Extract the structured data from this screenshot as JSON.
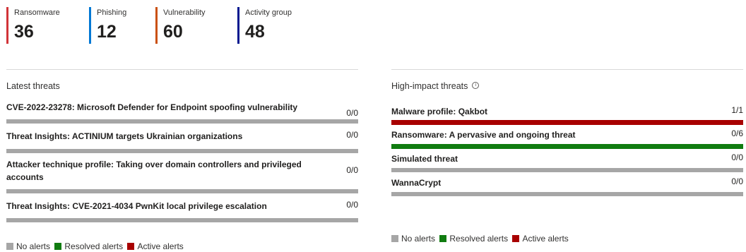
{
  "stats": [
    {
      "label": "Ransomware",
      "value": "36",
      "color": "#d13438"
    },
    {
      "label": "Phishing",
      "value": "12",
      "color": "#0078d4"
    },
    {
      "label": "Vulnerability",
      "value": "60",
      "color": "#ca5010"
    },
    {
      "label": "Activity group",
      "value": "48",
      "color": "#00188f"
    }
  ],
  "latest": {
    "title": "Latest threats",
    "rows": [
      {
        "name": "CVE-2022-23278: Microsoft Defender for Endpoint spoofing vulnerability",
        "count": "0/0",
        "bar_color": "#a6a6a6"
      },
      {
        "name": "Threat Insights: ACTINIUM targets Ukrainian organizations",
        "count": "0/0",
        "bar_color": "#a6a6a6"
      },
      {
        "name": "Attacker technique profile: Taking over domain controllers and privileged accounts",
        "count": "0/0",
        "bar_color": "#a6a6a6"
      },
      {
        "name": "Threat Insights: CVE-2021-4034 PwnKit local privilege escalation",
        "count": "0/0",
        "bar_color": "#a6a6a6"
      }
    ]
  },
  "high_impact": {
    "title": "High-impact threats",
    "info_icon": "info-icon",
    "rows": [
      {
        "name": "Malware profile: Qakbot",
        "count": "1/1",
        "bar_color": "#a80000"
      },
      {
        "name": "Ransomware: A pervasive and ongoing threat",
        "count": "0/6",
        "bar_color": "#107c10"
      },
      {
        "name": "Simulated threat",
        "count": "0/0",
        "bar_color": "#a6a6a6"
      },
      {
        "name": "WannaCrypt",
        "count": "0/0",
        "bar_color": "#a6a6a6"
      }
    ]
  },
  "legend": {
    "no_alerts": "No alerts",
    "resolved_alerts": "Resolved alerts",
    "active_alerts": "Active alerts",
    "no_alerts_color": "#a6a6a6",
    "resolved_color": "#107c10",
    "active_color": "#a80000"
  }
}
